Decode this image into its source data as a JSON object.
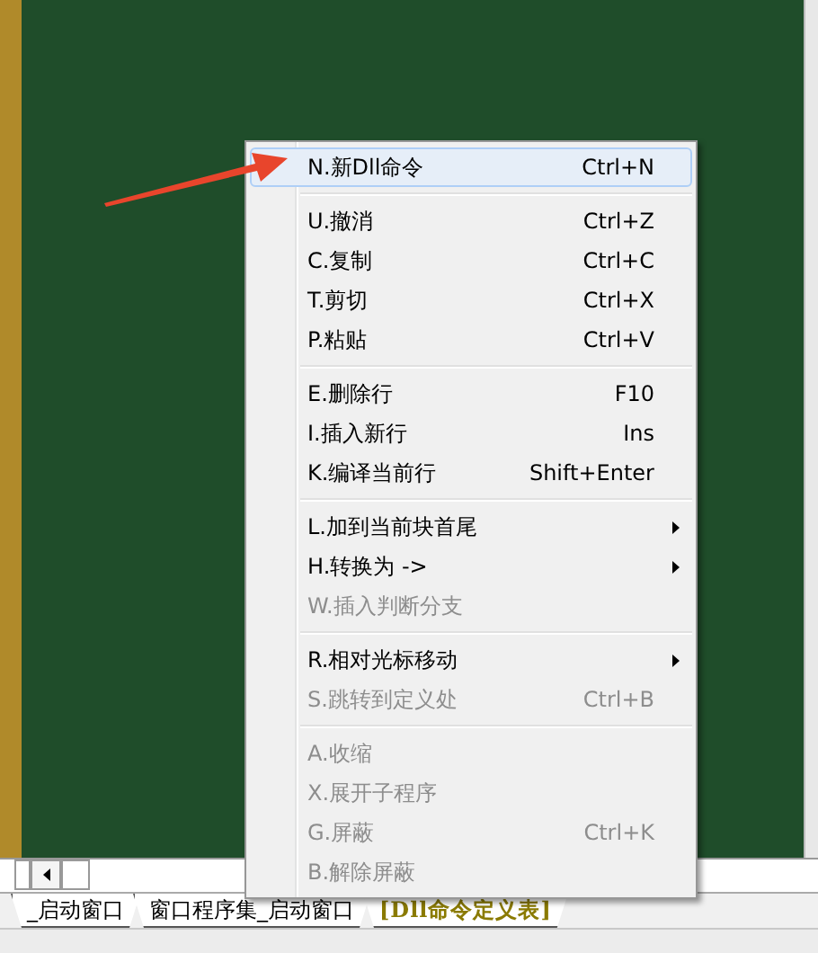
{
  "context_menu": {
    "items": [
      {
        "kind": "item",
        "label": "N.新Dll命令",
        "shortcut": "Ctrl+N",
        "disabled": false,
        "submenu": false,
        "selected": true
      },
      {
        "kind": "separator"
      },
      {
        "kind": "item",
        "label": "U.撤消",
        "shortcut": "Ctrl+Z",
        "disabled": false,
        "submenu": false,
        "selected": false
      },
      {
        "kind": "item",
        "label": "C.复制",
        "shortcut": "Ctrl+C",
        "disabled": false,
        "submenu": false,
        "selected": false
      },
      {
        "kind": "item",
        "label": "T.剪切",
        "shortcut": "Ctrl+X",
        "disabled": false,
        "submenu": false,
        "selected": false
      },
      {
        "kind": "item",
        "label": "P.粘贴",
        "shortcut": "Ctrl+V",
        "disabled": false,
        "submenu": false,
        "selected": false
      },
      {
        "kind": "separator"
      },
      {
        "kind": "item",
        "label": "E.删除行",
        "shortcut": "F10",
        "disabled": false,
        "submenu": false,
        "selected": false
      },
      {
        "kind": "item",
        "label": "I.插入新行",
        "shortcut": "Ins",
        "disabled": false,
        "submenu": false,
        "selected": false
      },
      {
        "kind": "item",
        "label": "K.编译当前行",
        "shortcut": "Shift+Enter",
        "disabled": false,
        "submenu": false,
        "selected": false
      },
      {
        "kind": "separator"
      },
      {
        "kind": "item",
        "label": "L.加到当前块首尾",
        "disabled": false,
        "submenu": true,
        "selected": false
      },
      {
        "kind": "item",
        "label": "H.转换为 ->",
        "disabled": false,
        "submenu": true,
        "selected": false
      },
      {
        "kind": "item",
        "label": "W.插入判断分支",
        "disabled": true,
        "submenu": false,
        "selected": false
      },
      {
        "kind": "separator"
      },
      {
        "kind": "item",
        "label": "R.相对光标移动",
        "disabled": false,
        "submenu": true,
        "selected": false
      },
      {
        "kind": "item",
        "label": "S.跳转到定义处",
        "shortcut": "Ctrl+B",
        "disabled": true,
        "submenu": false,
        "selected": false
      },
      {
        "kind": "separator"
      },
      {
        "kind": "item",
        "label": "A.收缩",
        "disabled": true,
        "submenu": false,
        "selected": false
      },
      {
        "kind": "item",
        "label": "X.展开子程序",
        "disabled": true,
        "submenu": false,
        "selected": false
      },
      {
        "kind": "item",
        "label": "G.屏蔽",
        "shortcut": "Ctrl+K",
        "disabled": true,
        "submenu": false,
        "selected": false
      },
      {
        "kind": "item",
        "label": "B.解除屏蔽",
        "disabled": true,
        "submenu": false,
        "selected": false
      }
    ]
  },
  "tabs": [
    {
      "label": "_启动窗口",
      "selected": false
    },
    {
      "label": "窗口程序集_启动窗口",
      "selected": false
    },
    {
      "label": "[Dll命令定义表]",
      "selected": true
    }
  ]
}
